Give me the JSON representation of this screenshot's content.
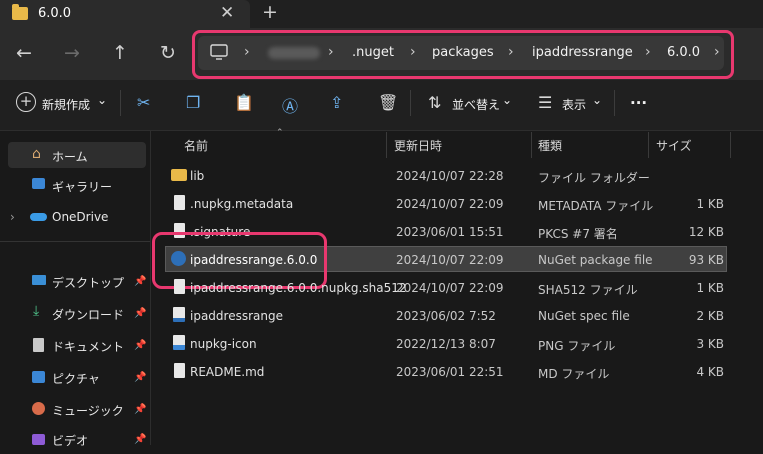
{
  "tab": {
    "title": "6.0.0",
    "close": "✕",
    "new_tab": "+"
  },
  "nav": {
    "back": "←",
    "forward": "→",
    "up": "↑",
    "refresh": "↻"
  },
  "breadcrumb": {
    "chevron": "›",
    "items": [
      ".nuget",
      "packages",
      "ipaddressrange",
      "6.0.0"
    ],
    "more": "›"
  },
  "toolbar": {
    "new_label": "新規作成",
    "sort_label": "並べ替え",
    "view_label": "表示",
    "more": "···",
    "chevron": "⌄"
  },
  "sidebar": {
    "items": [
      {
        "label": "ホーム",
        "icon": "home-icon",
        "pinned": false
      },
      {
        "label": "ギャラリー",
        "icon": "gallery-icon",
        "pinned": false
      },
      {
        "label": "OneDrive",
        "icon": "onedrive-icon",
        "pinned": false
      },
      {
        "label": "デスクトップ",
        "icon": "desktop-icon",
        "pinned": true
      },
      {
        "label": "ダウンロード",
        "icon": "download-icon",
        "pinned": true
      },
      {
        "label": "ドキュメント",
        "icon": "documents-icon",
        "pinned": true
      },
      {
        "label": "ピクチャ",
        "icon": "pictures-icon",
        "pinned": true
      },
      {
        "label": "ミュージック",
        "icon": "music-icon",
        "pinned": true
      },
      {
        "label": "ビデオ",
        "icon": "video-icon",
        "pinned": true
      }
    ],
    "expand_chevron": "›",
    "pin_glyph": "📌"
  },
  "columns": {
    "name": "名前",
    "modified": "更新日時",
    "type": "種類",
    "size": "サイズ"
  },
  "files": [
    {
      "name": "lib",
      "modified": "2024/10/07 22:28",
      "type": "ファイル フォルダー",
      "size": "",
      "icon": "folder-icon"
    },
    {
      "name": ".nupkg.metadata",
      "modified": "2024/10/07 22:09",
      "type": "METADATA ファイル",
      "size": "1 KB",
      "icon": "file-icon"
    },
    {
      "name": ".signature",
      "modified": "2023/06/01 15:51",
      "type": "PKCS #7 署名",
      "size": "12 KB",
      "icon": "file-icon"
    },
    {
      "name": "ipaddressrange.6.0.0",
      "modified": "2024/10/07 22:09",
      "type": "NuGet package file",
      "size": "93 KB",
      "icon": "nuget-icon",
      "selected": true
    },
    {
      "name": "ipaddressrange.6.0.0.nupkg.sha512",
      "modified": "2024/10/07 22:09",
      "type": "SHA512 ファイル",
      "size": "1 KB",
      "icon": "file-icon"
    },
    {
      "name": "ipaddressrange",
      "modified": "2023/06/02 7:52",
      "type": "NuGet spec file",
      "size": "2 KB",
      "icon": "nuspec-icon"
    },
    {
      "name": "nupkg-icon",
      "modified": "2022/12/13 8:07",
      "type": "PNG ファイル",
      "size": "3 KB",
      "icon": "png-icon"
    },
    {
      "name": "README.md",
      "modified": "2023/06/01 22:51",
      "type": "MD ファイル",
      "size": "4 KB",
      "icon": "file-icon"
    }
  ],
  "colors": {
    "highlight": "#e8386f",
    "accent": "#6fb4f0",
    "folder": "#e9b949"
  }
}
